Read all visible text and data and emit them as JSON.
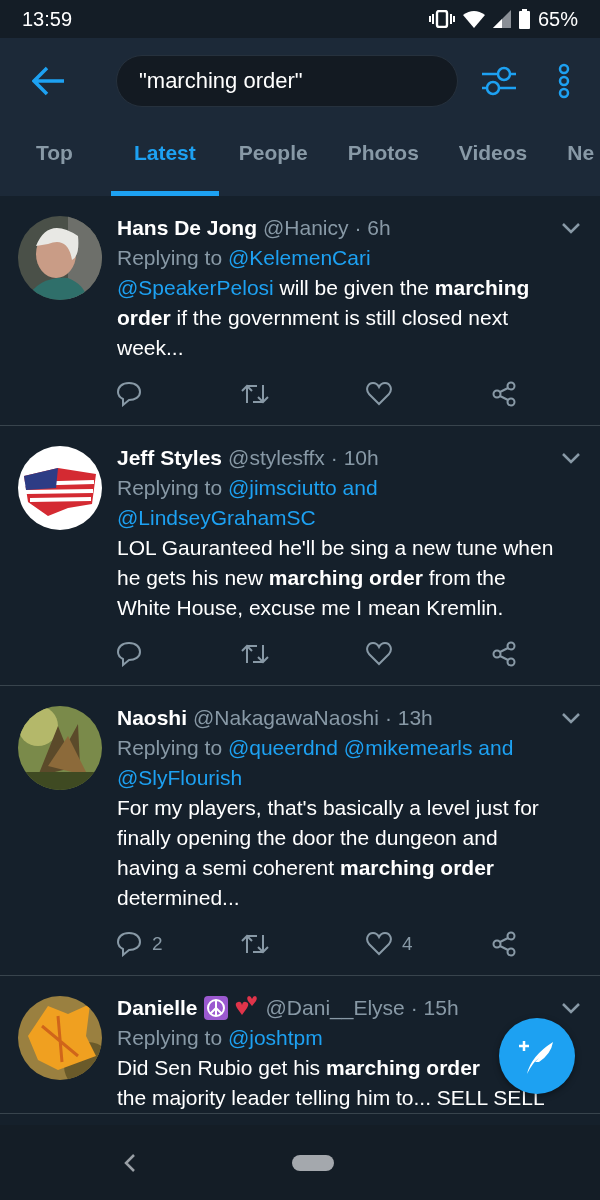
{
  "status_bar": {
    "time": "13:59",
    "battery": "65%"
  },
  "search": {
    "value": "\"marching order\""
  },
  "tabs": [
    {
      "label": "Top",
      "selected": false
    },
    {
      "label": "Latest",
      "selected": true
    },
    {
      "label": "People",
      "selected": false
    },
    {
      "label": "Photos",
      "selected": false
    },
    {
      "label": "Videos",
      "selected": false
    },
    {
      "label": "Ne",
      "selected": false
    }
  ],
  "tweets": [
    {
      "name": "Hans De Jong",
      "handle": "@Hanicy",
      "time": "· 6h",
      "reply_label": "Replying to",
      "reply_to": [
        "@KelemenCari"
      ],
      "lines": [
        {
          "mention": "@SpeakerPelosi",
          "text": "will be given the **marching**"
        },
        {
          "text": "**order** if the government is still closed next"
        },
        {
          "text": "week..."
        }
      ],
      "actions": [
        {
          "kind": "reply"
        },
        {
          "kind": "retweet"
        },
        {
          "kind": "like"
        },
        {
          "kind": "share"
        }
      ]
    },
    {
      "name": "Jeff Styles",
      "handle": "@stylesffx",
      "time": "· 10h",
      "reply_label": "Replying to",
      "reply_to": [
        "@jimsciutto and",
        "@LindseyGrahamSC"
      ],
      "lines": [
        {
          "text": "LOL Gauranteed he'll be sing a new tune when"
        },
        {
          "text": "he gets his new **marching order** from the"
        },
        {
          "text": "White House, excuse me I mean Kremlin."
        }
      ],
      "actions": [
        {
          "kind": "reply"
        },
        {
          "kind": "retweet"
        },
        {
          "kind": "like"
        },
        {
          "kind": "share"
        }
      ]
    },
    {
      "name": "Naoshi",
      "handle": "@NakagawaNaoshi",
      "time": "· 13h",
      "reply_label": "Replying to",
      "reply_to": [
        "@queerdnd",
        "@mikemearls and",
        "@SlyFlourish"
      ],
      "lines": [
        {
          "text": "For my players, that's basically a level just for"
        },
        {
          "text": "finally opening the door the dungeon and"
        },
        {
          "text": "having a semi coherent **marching order**"
        },
        {
          "text": "determined..."
        }
      ],
      "actions": [
        {
          "kind": "reply",
          "count": "2"
        },
        {
          "kind": "retweet"
        },
        {
          "kind": "like",
          "count": "4"
        },
        {
          "kind": "share"
        }
      ]
    },
    {
      "name": "Danielle",
      "emoji": [
        {
          "kind": "peace"
        },
        {
          "kind": "hearts"
        }
      ],
      "handle": "@Dani__Elyse",
      "time": "· 15h",
      "reply_label": "Replying to",
      "reply_to": [
        "@joshtpm"
      ],
      "lines": [
        {
          "text": "Did Sen Rubio get his **marching order**"
        },
        {
          "text": "the majority leader telling him to... SELL SELL"
        }
      ]
    }
  ]
}
